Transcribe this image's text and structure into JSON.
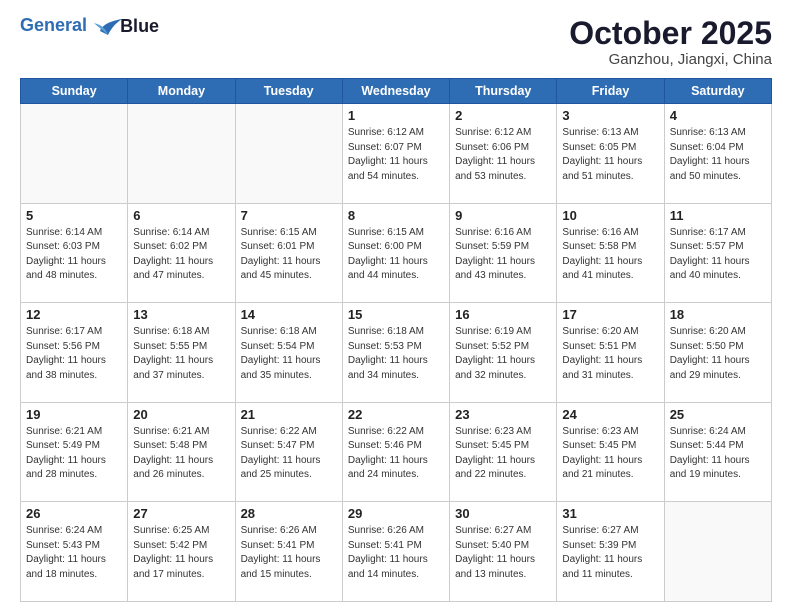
{
  "header": {
    "logo_line1": "General",
    "logo_line2": "Blue",
    "month": "October 2025",
    "location": "Ganzhou, Jiangxi, China"
  },
  "weekdays": [
    "Sunday",
    "Monday",
    "Tuesday",
    "Wednesday",
    "Thursday",
    "Friday",
    "Saturday"
  ],
  "weeks": [
    [
      {
        "day": "",
        "info": ""
      },
      {
        "day": "",
        "info": ""
      },
      {
        "day": "",
        "info": ""
      },
      {
        "day": "1",
        "info": "Sunrise: 6:12 AM\nSunset: 6:07 PM\nDaylight: 11 hours\nand 54 minutes."
      },
      {
        "day": "2",
        "info": "Sunrise: 6:12 AM\nSunset: 6:06 PM\nDaylight: 11 hours\nand 53 minutes."
      },
      {
        "day": "3",
        "info": "Sunrise: 6:13 AM\nSunset: 6:05 PM\nDaylight: 11 hours\nand 51 minutes."
      },
      {
        "day": "4",
        "info": "Sunrise: 6:13 AM\nSunset: 6:04 PM\nDaylight: 11 hours\nand 50 minutes."
      }
    ],
    [
      {
        "day": "5",
        "info": "Sunrise: 6:14 AM\nSunset: 6:03 PM\nDaylight: 11 hours\nand 48 minutes."
      },
      {
        "day": "6",
        "info": "Sunrise: 6:14 AM\nSunset: 6:02 PM\nDaylight: 11 hours\nand 47 minutes."
      },
      {
        "day": "7",
        "info": "Sunrise: 6:15 AM\nSunset: 6:01 PM\nDaylight: 11 hours\nand 45 minutes."
      },
      {
        "day": "8",
        "info": "Sunrise: 6:15 AM\nSunset: 6:00 PM\nDaylight: 11 hours\nand 44 minutes."
      },
      {
        "day": "9",
        "info": "Sunrise: 6:16 AM\nSunset: 5:59 PM\nDaylight: 11 hours\nand 43 minutes."
      },
      {
        "day": "10",
        "info": "Sunrise: 6:16 AM\nSunset: 5:58 PM\nDaylight: 11 hours\nand 41 minutes."
      },
      {
        "day": "11",
        "info": "Sunrise: 6:17 AM\nSunset: 5:57 PM\nDaylight: 11 hours\nand 40 minutes."
      }
    ],
    [
      {
        "day": "12",
        "info": "Sunrise: 6:17 AM\nSunset: 5:56 PM\nDaylight: 11 hours\nand 38 minutes."
      },
      {
        "day": "13",
        "info": "Sunrise: 6:18 AM\nSunset: 5:55 PM\nDaylight: 11 hours\nand 37 minutes."
      },
      {
        "day": "14",
        "info": "Sunrise: 6:18 AM\nSunset: 5:54 PM\nDaylight: 11 hours\nand 35 minutes."
      },
      {
        "day": "15",
        "info": "Sunrise: 6:18 AM\nSunset: 5:53 PM\nDaylight: 11 hours\nand 34 minutes."
      },
      {
        "day": "16",
        "info": "Sunrise: 6:19 AM\nSunset: 5:52 PM\nDaylight: 11 hours\nand 32 minutes."
      },
      {
        "day": "17",
        "info": "Sunrise: 6:20 AM\nSunset: 5:51 PM\nDaylight: 11 hours\nand 31 minutes."
      },
      {
        "day": "18",
        "info": "Sunrise: 6:20 AM\nSunset: 5:50 PM\nDaylight: 11 hours\nand 29 minutes."
      }
    ],
    [
      {
        "day": "19",
        "info": "Sunrise: 6:21 AM\nSunset: 5:49 PM\nDaylight: 11 hours\nand 28 minutes."
      },
      {
        "day": "20",
        "info": "Sunrise: 6:21 AM\nSunset: 5:48 PM\nDaylight: 11 hours\nand 26 minutes."
      },
      {
        "day": "21",
        "info": "Sunrise: 6:22 AM\nSunset: 5:47 PM\nDaylight: 11 hours\nand 25 minutes."
      },
      {
        "day": "22",
        "info": "Sunrise: 6:22 AM\nSunset: 5:46 PM\nDaylight: 11 hours\nand 24 minutes."
      },
      {
        "day": "23",
        "info": "Sunrise: 6:23 AM\nSunset: 5:45 PM\nDaylight: 11 hours\nand 22 minutes."
      },
      {
        "day": "24",
        "info": "Sunrise: 6:23 AM\nSunset: 5:45 PM\nDaylight: 11 hours\nand 21 minutes."
      },
      {
        "day": "25",
        "info": "Sunrise: 6:24 AM\nSunset: 5:44 PM\nDaylight: 11 hours\nand 19 minutes."
      }
    ],
    [
      {
        "day": "26",
        "info": "Sunrise: 6:24 AM\nSunset: 5:43 PM\nDaylight: 11 hours\nand 18 minutes."
      },
      {
        "day": "27",
        "info": "Sunrise: 6:25 AM\nSunset: 5:42 PM\nDaylight: 11 hours\nand 17 minutes."
      },
      {
        "day": "28",
        "info": "Sunrise: 6:26 AM\nSunset: 5:41 PM\nDaylight: 11 hours\nand 15 minutes."
      },
      {
        "day": "29",
        "info": "Sunrise: 6:26 AM\nSunset: 5:41 PM\nDaylight: 11 hours\nand 14 minutes."
      },
      {
        "day": "30",
        "info": "Sunrise: 6:27 AM\nSunset: 5:40 PM\nDaylight: 11 hours\nand 13 minutes."
      },
      {
        "day": "31",
        "info": "Sunrise: 6:27 AM\nSunset: 5:39 PM\nDaylight: 11 hours\nand 11 minutes."
      },
      {
        "day": "",
        "info": ""
      }
    ]
  ]
}
